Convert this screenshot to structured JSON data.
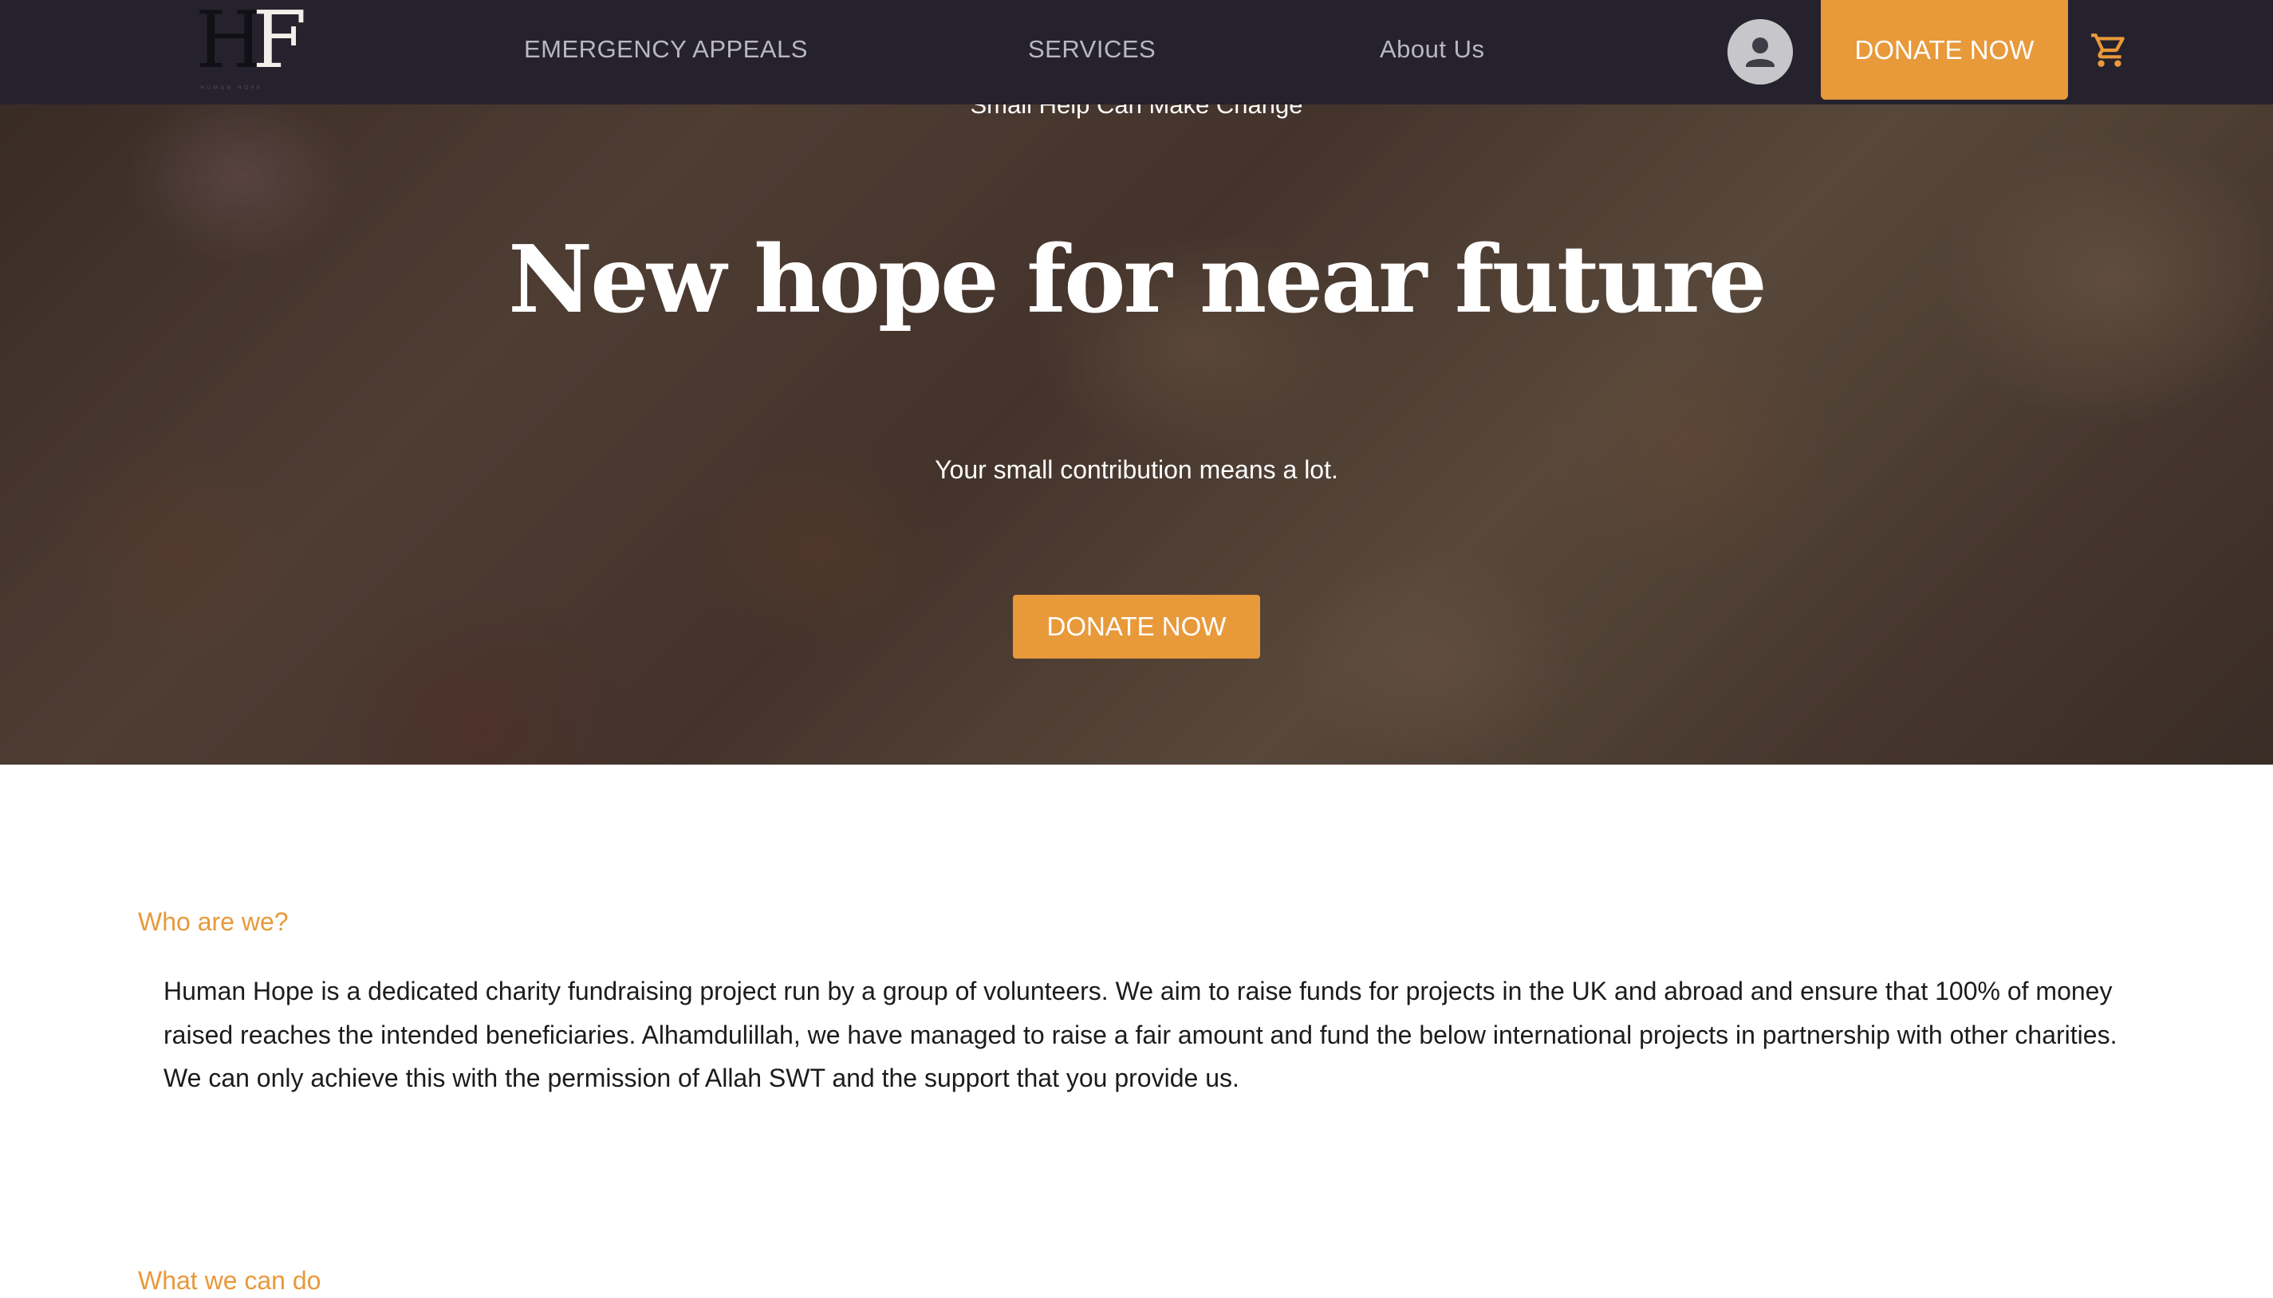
{
  "header": {
    "logo_text": "HF",
    "logo_subtext": "HUMAN HOPE",
    "nav": {
      "emergency": "EMERGENCY APPEALS",
      "services": "SERVICES",
      "about": "About Us"
    },
    "donate_label": "DONATE NOW",
    "icons": {
      "account": "user-circle-icon",
      "cart": "shopping-cart-icon"
    }
  },
  "hero": {
    "kicker": "Small Help Can Make Change",
    "title": "New hope for near future",
    "subtitle": "Your small contribution means a lot.",
    "donate_label": "DONATE NOW"
  },
  "about": {
    "label": "Who are we?",
    "text": "Human Hope is a dedicated charity fundraising project run by a group of volunteers. We aim to raise funds for projects in the UK and abroad and ensure that 100% of money raised reaches the intended beneficiaries. Alhamdulillah, we have managed to raise a fair amount and fund the below international projects in partnership with other charities. We can only achieve this with the permission of Allah SWT and the support that you provide us."
  },
  "what": {
    "label": "What we can do"
  },
  "colors": {
    "nav_bg": "#25222d",
    "accent": "#e8993a",
    "nav_text": "#b9b7bf",
    "body_text": "#1c1c1c"
  }
}
